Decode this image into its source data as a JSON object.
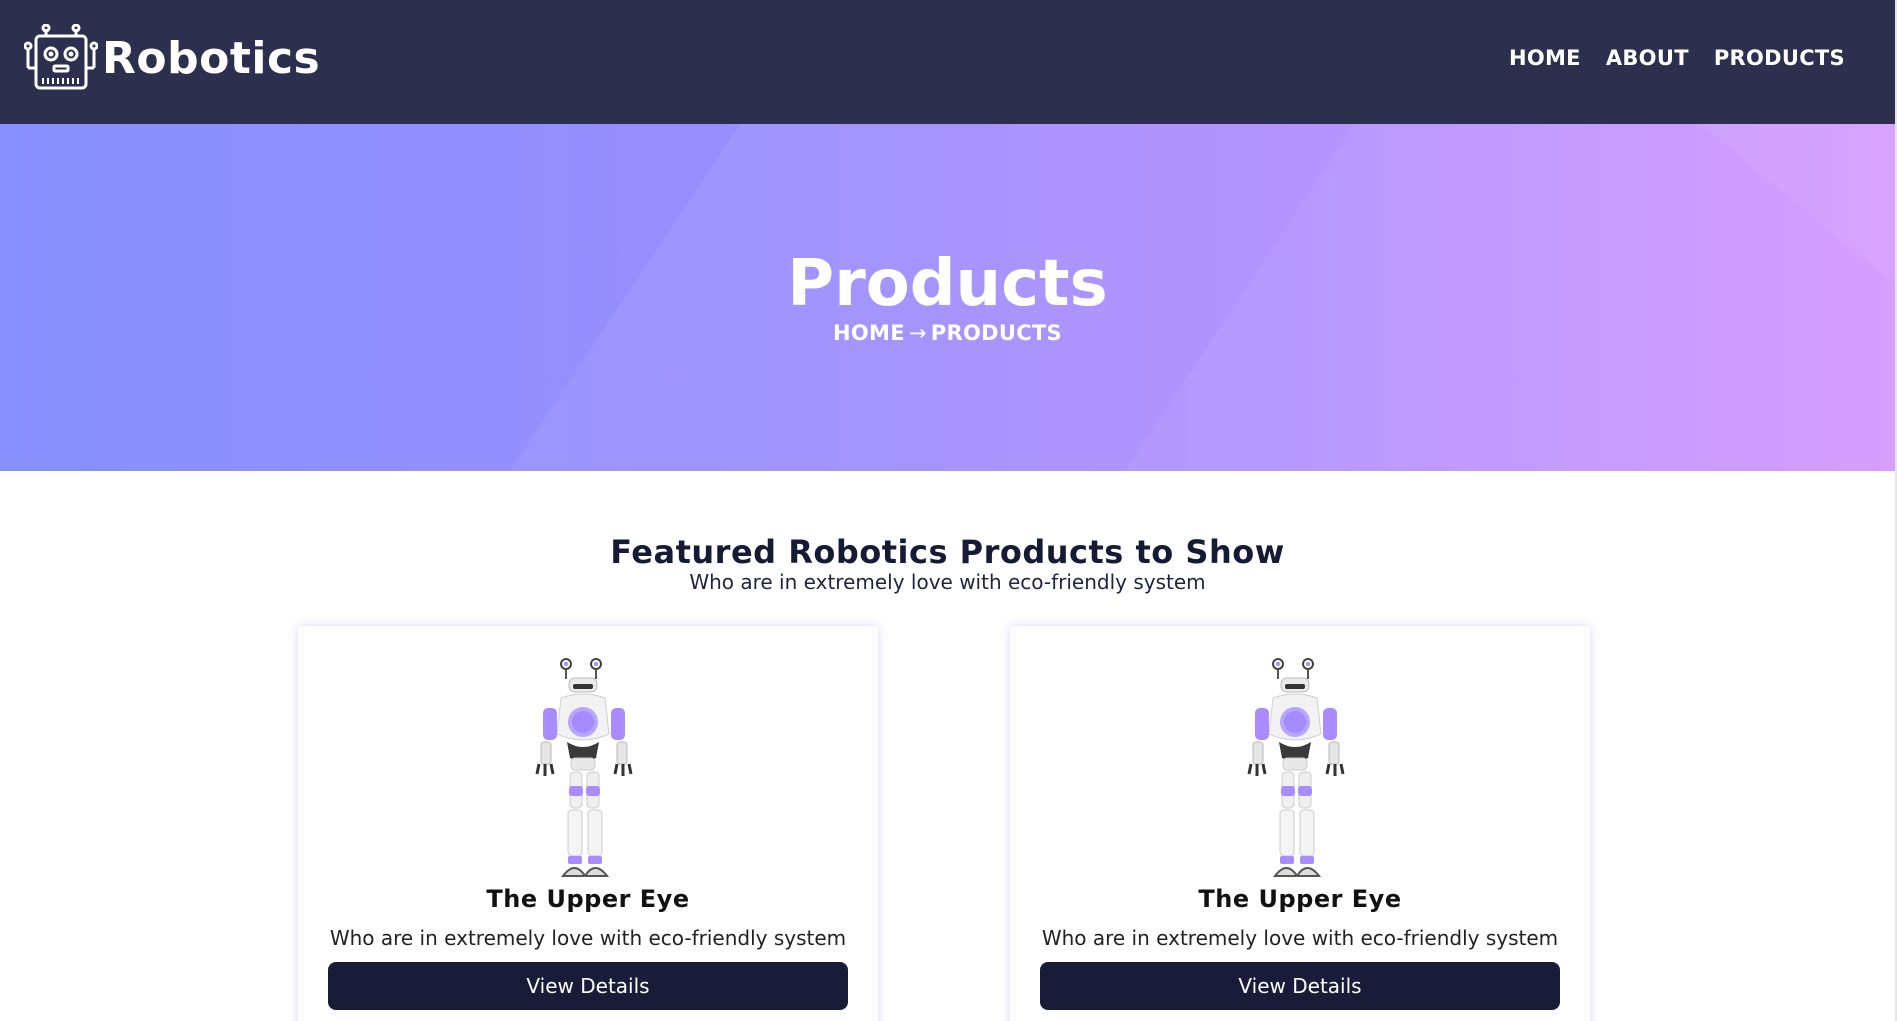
{
  "header": {
    "brand": "Robotics",
    "logo_icon": "robot-head-icon",
    "nav": [
      {
        "label": "HOME"
      },
      {
        "label": "ABOUT"
      },
      {
        "label": "PRODUCTS"
      }
    ]
  },
  "hero": {
    "title": "Products",
    "breadcrumb": {
      "home": "HOME",
      "separator": "→",
      "current": "PRODUCTS"
    }
  },
  "section": {
    "title": "Featured Robotics Products to Show",
    "subtitle": "Who are in extremely love with eco-friendly system"
  },
  "products": [
    {
      "image_icon": "robot-illustration",
      "title": "The Upper Eye",
      "description": "Who are in extremely love with eco-friendly system",
      "button": "View Details"
    },
    {
      "image_icon": "robot-illustration",
      "title": "The Upper Eye",
      "description": "Who are in extremely love with eco-friendly system",
      "button": "View Details"
    }
  ],
  "colors": {
    "header_bg": "#2c2f4d",
    "hero_gradient_start": "#8690fe",
    "hero_gradient_end": "#d293fe",
    "button_bg": "#181c38",
    "accent_purple": "#a98cff"
  }
}
